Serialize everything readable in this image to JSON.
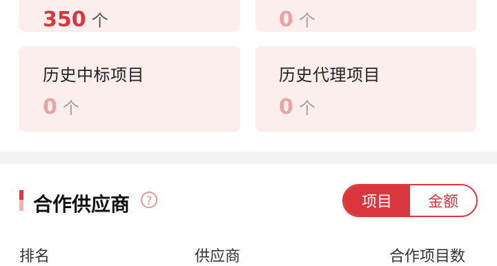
{
  "stats": {
    "cards": [
      {
        "title": "",
        "value": "350",
        "unit": "个"
      },
      {
        "title": "",
        "value": "0",
        "unit": "个"
      },
      {
        "title": "历史中标项目",
        "value": "0",
        "unit": "个"
      },
      {
        "title": "历史代理项目",
        "value": "0",
        "unit": "个"
      }
    ]
  },
  "section": {
    "title": "合作供应商",
    "help_icon": "help-circle-icon",
    "toggle": {
      "options": [
        "项目",
        "金额"
      ],
      "selected": "项目"
    }
  },
  "table": {
    "headers": [
      "排名",
      "供应商",
      "合作项目数"
    ]
  },
  "colors": {
    "accent": "#d9363e",
    "card_bg": "#fdeeee",
    "muted_value": "#e9a3a3"
  }
}
